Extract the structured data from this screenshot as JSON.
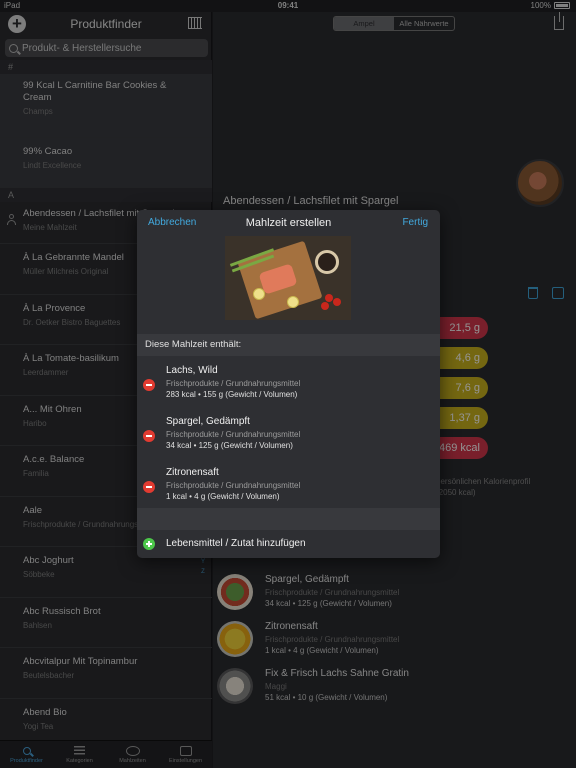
{
  "status": {
    "device": "iPad",
    "time": "09:41",
    "battery": "100%"
  },
  "left": {
    "title": "Produktfinder",
    "search_placeholder": "Produkt- & Herstellersuche",
    "sections": [
      {
        "header": "#",
        "items": [
          {
            "name": "99 Kcal L Carnitine Bar Cookies & Cream",
            "sub": "Champs"
          },
          {
            "name": "99% Cacao",
            "sub": "Lindt Excellence"
          }
        ]
      },
      {
        "header": "A",
        "items": [
          {
            "name": "Abendessen / Lachsfilet mit Spargel",
            "sub": "Meine Mahlzeit"
          },
          {
            "name": "À La Gebrannte Mandel",
            "sub": "Müller Milchreis Original"
          },
          {
            "name": "À La Provence",
            "sub": "Dr. Oetker Bistro Baguettes"
          },
          {
            "name": "À La Tomate-basilikum",
            "sub": "Leerdammer"
          },
          {
            "name": "A... Mit Ohren",
            "sub": "Haribo"
          },
          {
            "name": "A.c.e. Balance",
            "sub": "Familia"
          },
          {
            "name": "Aale",
            "sub": "Frischprodukte / Grundnahrungsmittel"
          },
          {
            "name": "Abc Joghurt",
            "sub": "Söbbeke"
          },
          {
            "name": "Abc Russisch Brot",
            "sub": "Bahlsen"
          },
          {
            "name": "Abcvitalpur Mit Topinambur",
            "sub": "Beutelsbacher"
          },
          {
            "name": "Abend Bio",
            "sub": "Yogi Tea"
          }
        ]
      }
    ],
    "index_letters": [
      "Y",
      "Z"
    ],
    "tabs": [
      "Produktfinder",
      "Kategorien",
      "Mahlzeiten",
      "Einstellungen"
    ]
  },
  "right": {
    "segment": [
      "Ampel",
      "Alle Nährwerte"
    ],
    "title": "Abendessen / Lachsfilet mit Spargel",
    "pills": [
      {
        "value": "21,5 g",
        "color": "#d0364a"
      },
      {
        "value": "4,6 g",
        "color": "#c9b21e"
      },
      {
        "value": "7,6 g",
        "color": "#c9b21e"
      },
      {
        "value": "1,37 g",
        "color": "#c9b21e"
      },
      {
        "value": "469 kcal",
        "color": "#d0364a"
      }
    ],
    "profile_note_1": "persönlichen Kalorienprofil",
    "profile_note_2": "(2050 kcal)",
    "ingredients": [
      {
        "name": "Spargel, Gedämpft",
        "cat": "Frischprodukte / Grundnahrungsmittel",
        "val": "34 kcal  •  125 g (Gewicht / Volumen)"
      },
      {
        "name": "Zitronensaft",
        "cat": "Frischprodukte / Grundnahrungsmittel",
        "val": "1 kcal  •  4 g (Gewicht / Volumen)"
      },
      {
        "name": "Fix & Frisch Lachs Sahne Gratin",
        "cat": "Maggi",
        "val": "51 kcal  •  10 g (Gewicht / Volumen)"
      }
    ]
  },
  "modal": {
    "cancel": "Abbrechen",
    "title": "Mahlzeit erstellen",
    "done": "Fertig",
    "section": "Diese Mahlzeit enthält:",
    "items": [
      {
        "name": "Lachs, Wild",
        "cat": "Frischprodukte / Grundnahrungsmittel",
        "val": "283 kcal  •  155 g (Gewicht / Volumen)"
      },
      {
        "name": "Spargel, Gedämpft",
        "cat": "Frischprodukte / Grundnahrungsmittel",
        "val": "34 kcal  •  125 g (Gewicht / Volumen)"
      },
      {
        "name": "Zitronensaft",
        "cat": "Frischprodukte / Grundnahrungsmittel",
        "val": "1 kcal  •  4 g (Gewicht / Volumen)"
      }
    ],
    "add_label": "Lebensmittel / Zutat hinzufügen"
  }
}
